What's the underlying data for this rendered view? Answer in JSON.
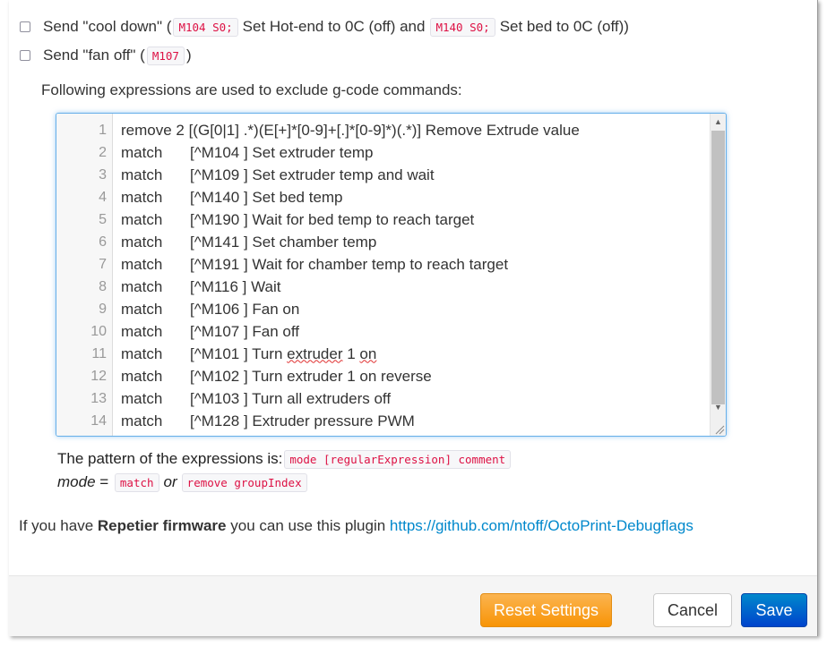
{
  "options": {
    "cool_down": {
      "prefix": "Send \"cool down\" (",
      "code1": "M104 S0;",
      "mid": "Set Hot-end to 0C (off) and",
      "code2": "M140 S0;",
      "suffix": "Set bed to 0C (off))",
      "checked": false
    },
    "fan_off": {
      "prefix": "Send \"fan off\" (",
      "code": "M107",
      "suffix": ")",
      "checked": false
    }
  },
  "expressions_intro": "Following expressions are used to exclude g-code commands:",
  "editor": {
    "first_line": {
      "num": "1",
      "text": "remove 2 [(G[0|1] .*)(E[+]*[0-9]+[.]*[0-9]*)(.*)] Remove Extrude value"
    },
    "lines": [
      {
        "num": "2",
        "mode": "match",
        "expr": "[^M104 ] Set extruder temp"
      },
      {
        "num": "3",
        "mode": "match",
        "expr": "[^M109 ] Set extruder temp and wait"
      },
      {
        "num": "4",
        "mode": "match",
        "expr": "[^M140 ] Set bed temp"
      },
      {
        "num": "5",
        "mode": "match",
        "expr": "[^M190 ] Wait for bed temp to reach target"
      },
      {
        "num": "6",
        "mode": "match",
        "expr": "[^M141 ] Set chamber temp"
      },
      {
        "num": "7",
        "mode": "match",
        "expr": "[^M191 ] Wait for chamber temp to reach target"
      },
      {
        "num": "8",
        "mode": "match",
        "expr": "[^M116 ] Wait"
      },
      {
        "num": "9",
        "mode": "match",
        "expr": "[^M106 ] Fan on"
      },
      {
        "num": "10",
        "mode": "match",
        "expr": "[^M107 ] Fan off"
      },
      {
        "num": "11",
        "mode": "match",
        "expr": "[^M101 ] Turn extruder 1 on"
      },
      {
        "num": "12",
        "mode": "match",
        "expr": "[^M102 ] Turn extruder 1 on reverse"
      },
      {
        "num": "13",
        "mode": "match",
        "expr": "[^M103 ] Turn all extruders off"
      },
      {
        "num": "14",
        "mode": "match",
        "expr": "[^M128 ] Extruder pressure PWM"
      }
    ]
  },
  "pattern_help": {
    "label": "The pattern of the expressions is:",
    "pattern_code": "mode [regularExpression] comment",
    "mode_label": "mode",
    "equals": " = ",
    "match_code": "match",
    "or_word": "or",
    "remove_code": "remove groupIndex"
  },
  "repetier": {
    "prefix": "If you have ",
    "bold": "Repetier firmware",
    "middle": " you can use this plugin ",
    "link": "https://github.com/ntoff/OctoPrint-Debugflags"
  },
  "footer": {
    "reset_label": "Reset Settings",
    "cancel_label": "Cancel",
    "save_label": "Save"
  },
  "colors": {
    "warning": "#f89406",
    "primary": "#0044cc",
    "link": "#0088cc",
    "code": "#dd1144"
  }
}
